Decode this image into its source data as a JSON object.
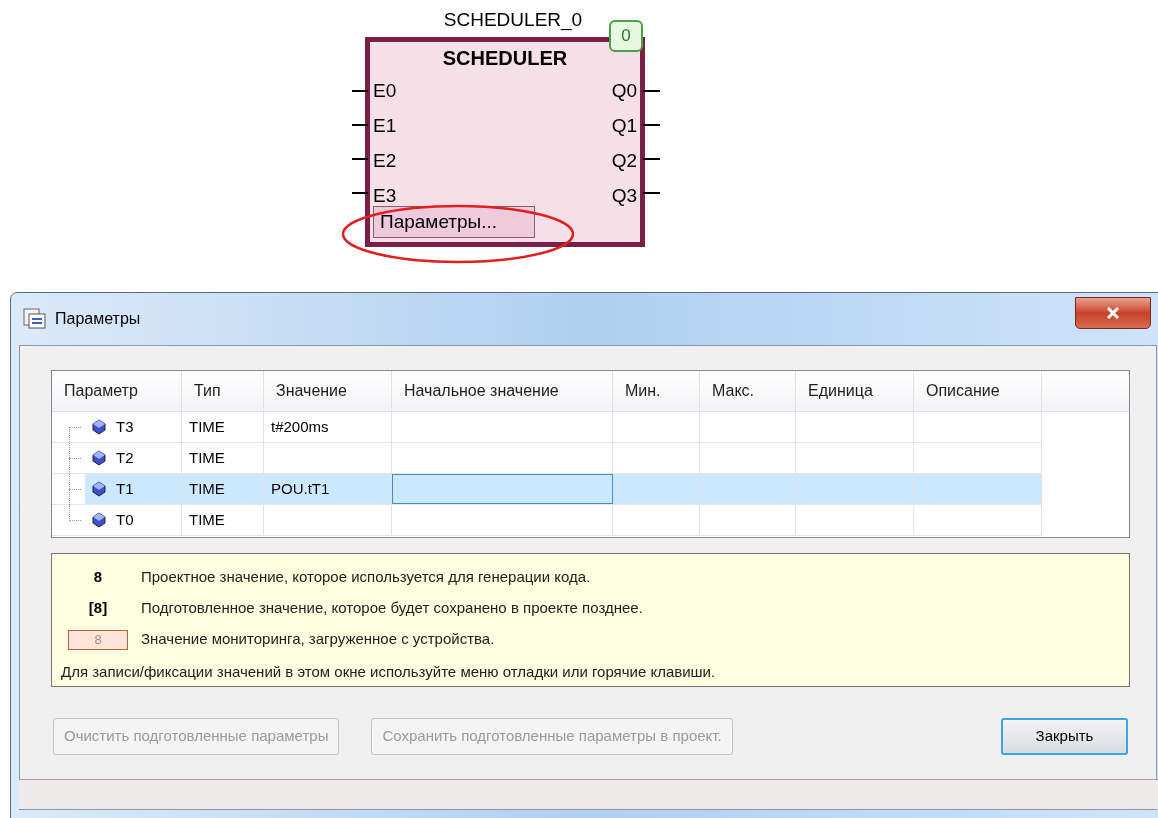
{
  "block": {
    "instance": "SCHEDULER_0",
    "type": "SCHEDULER",
    "badge": "0",
    "inputs": [
      "E0",
      "E1",
      "E2",
      "E3"
    ],
    "outputs": [
      "Q0",
      "Q1",
      "Q2",
      "Q3"
    ],
    "params_button": "Параметры...",
    "highlighted": true
  },
  "dialog": {
    "title": "Параметры",
    "table": {
      "columns": [
        "Параметр",
        "Тип",
        "Значение",
        "Начальное значение",
        "Мин.",
        "Макс.",
        "Единица",
        "Описание"
      ],
      "rows": [
        {
          "name": "T3",
          "type": "TIME",
          "value": "t#200ms",
          "selected": false
        },
        {
          "name": "T2",
          "type": "TIME",
          "selected": false
        },
        {
          "name": "T1",
          "type": "TIME",
          "value": "POU.tT1",
          "selected": true
        },
        {
          "name": "T0",
          "type": "TIME",
          "selected": false
        }
      ]
    },
    "legend": {
      "items": [
        {
          "kind": "project",
          "sample": "8",
          "text": "Проектное значение, которое используется для генерации кода."
        },
        {
          "kind": "prepared",
          "sample": "[8]",
          "text": "Подготовленное значение, которое будет сохранено в проекте позднее."
        },
        {
          "kind": "monitoring",
          "sample": "8",
          "text": "Значение мониторинга, загруженное с устройства."
        }
      ],
      "note": "Для записи/фиксации значений в этом окне используйте меню отладки или горячие клавиши."
    },
    "buttons": [
      {
        "label": "Очистить подготовленные параметры",
        "disabled": true,
        "default": false
      },
      {
        "label": "Сохранить подготовленные параметры в проект.",
        "disabled": true,
        "default": false
      },
      {
        "label": "Закрыть",
        "disabled": false,
        "default": true
      }
    ]
  }
}
